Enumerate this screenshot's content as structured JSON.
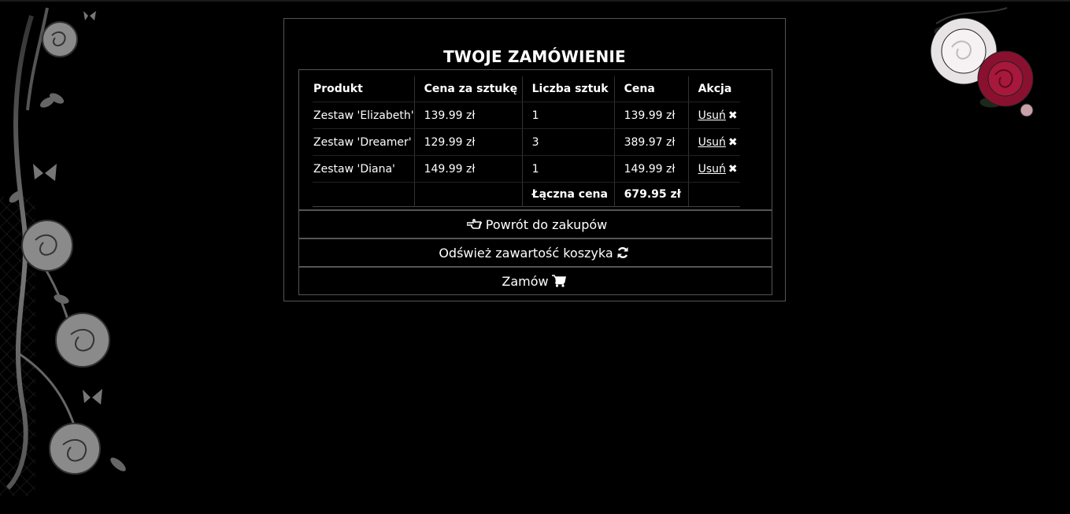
{
  "cart": {
    "title": "TWOJE ZAMÓWIENIE",
    "columns": [
      "Produkt",
      "Cena za sztukę",
      "Liczba sztuk",
      "Cena",
      "Akcja"
    ],
    "rows": [
      {
        "product": "Zestaw 'Elizabeth'",
        "unit_price": "139.99 zł",
        "quantity": "1",
        "price": "139.99 zł",
        "action": "Usuń"
      },
      {
        "product": "Zestaw 'Dreamer'",
        "unit_price": "129.99 zł",
        "quantity": "3",
        "price": "389.97 zł",
        "action": "Usuń"
      },
      {
        "product": "Zestaw 'Diana'",
        "unit_price": "149.99 zł",
        "quantity": "1",
        "price": "149.99 zł",
        "action": "Usuń"
      }
    ],
    "total_label": "Łączna cena",
    "total_value": "679.95 zł"
  },
  "buttons": {
    "back": "Powrót do zakupów",
    "refresh": "Odśwież zawartość koszyka",
    "order": "Zamów"
  },
  "icons": {
    "back": "hand-pointing-left-icon",
    "refresh": "refresh-icon",
    "order": "shopping-cart-icon",
    "remove": "close-x-icon"
  },
  "colors": {
    "background": "#000000",
    "text": "#ffffff",
    "border": "#555555"
  }
}
